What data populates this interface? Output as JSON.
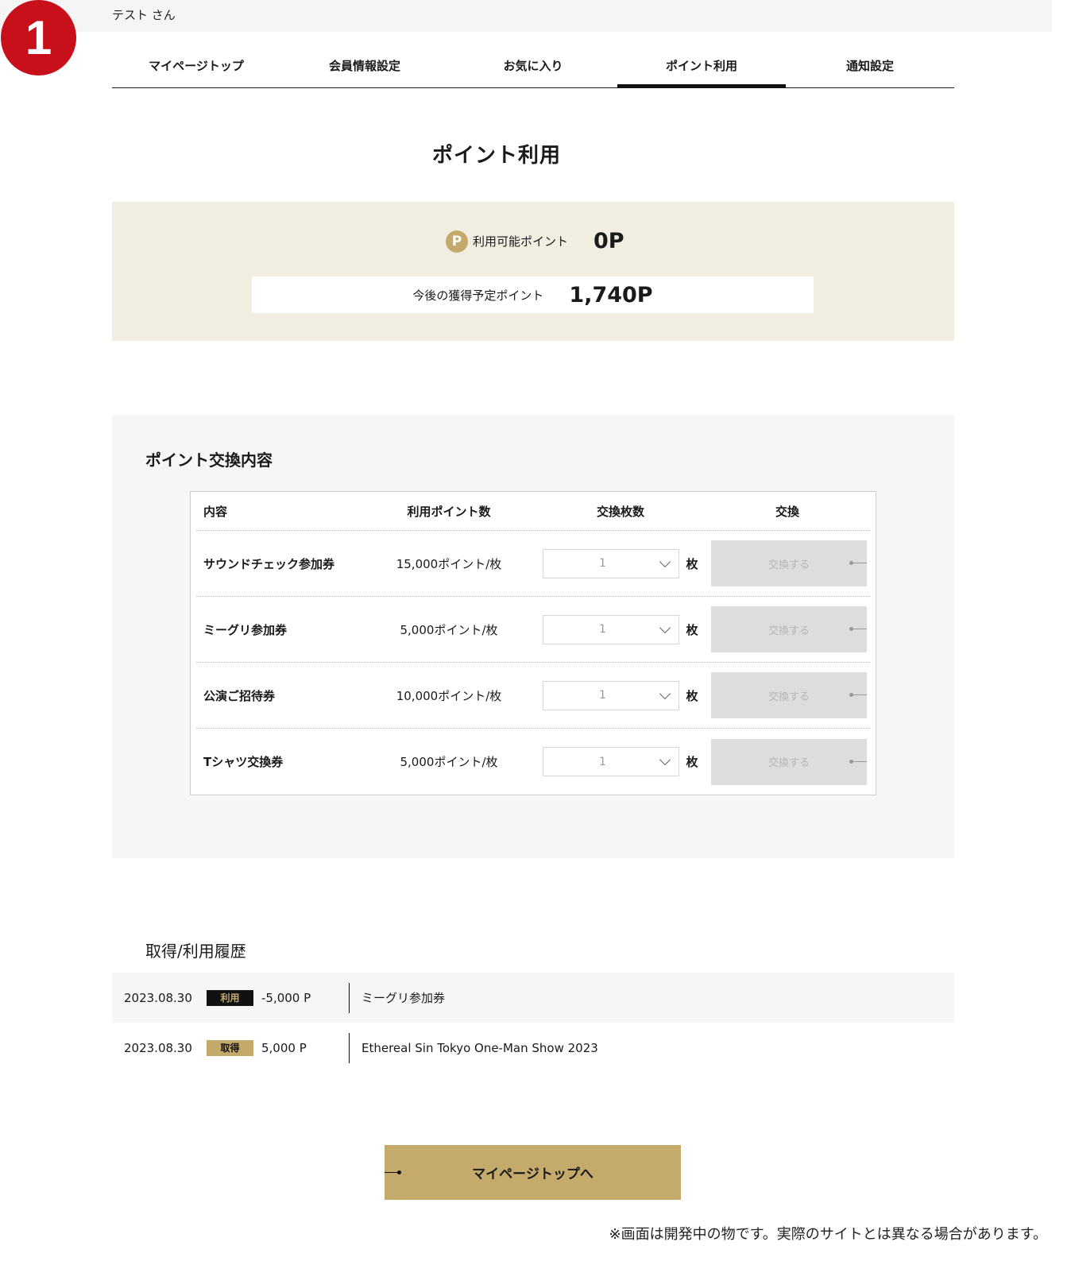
{
  "step_badge": "1",
  "user": {
    "name": "テスト さん"
  },
  "tabs": [
    {
      "label": "マイページトップ",
      "active": false
    },
    {
      "label": "会員情報設定",
      "active": false
    },
    {
      "label": "お気に入り",
      "active": false
    },
    {
      "label": "ポイント利用",
      "active": true
    },
    {
      "label": "通知設定",
      "active": false
    }
  ],
  "page_title": "ポイント利用",
  "points": {
    "icon_letter": "P",
    "available_label": "利用可能ポイント",
    "available_value": "0P",
    "future_label": "今後の獲得予定ポイント",
    "future_value": "1,740P"
  },
  "exchange": {
    "title": "ポイント交換内容",
    "headers": {
      "name": "内容",
      "points": "利用ポイント数",
      "qty": "交換枚数",
      "action": "交換"
    },
    "unit": "枚",
    "button_label": "交換する",
    "rows": [
      {
        "name": "サウンドチェック参加券",
        "points": "15,000ポイント/枚",
        "qty": "1"
      },
      {
        "name": "ミーグリ参加券",
        "points": "5,000ポイント/枚",
        "qty": "1"
      },
      {
        "name": "公演ご招待券",
        "points": "10,000ポイント/枚",
        "qty": "1"
      },
      {
        "name": "Tシャツ交換券",
        "points": "5,000ポイント/枚",
        "qty": "1"
      }
    ]
  },
  "history": {
    "title": "取得/利用履歴",
    "rows": [
      {
        "date": "2023.08.30",
        "type": "利用",
        "amount": "-5,000 P",
        "desc": "ミーグリ参加券"
      },
      {
        "date": "2023.08.30",
        "type": "取得",
        "amount": "5,000 P",
        "desc": "Ethereal Sin Tokyo One-Man Show 2023"
      }
    ]
  },
  "back_button": "マイページトップへ",
  "notice": "※画面は開発中の物です。実際のサイトとは異なる場合があります。",
  "colors": {
    "badge": "#c8101a",
    "gold": "#c4a96a",
    "beige": "#f2ede1",
    "panel": "#f5f6f7"
  }
}
